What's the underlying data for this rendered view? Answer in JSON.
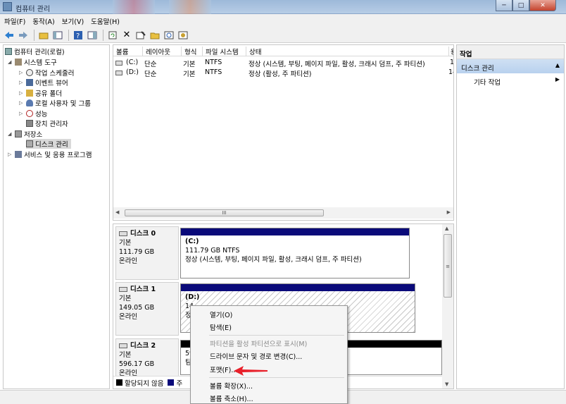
{
  "window": {
    "title": "컴퓨터 관리"
  },
  "menu": [
    "파일(F)",
    "동작(A)",
    "보기(V)",
    "도움말(H)"
  ],
  "toolbar_icons": [
    "back-arrow-icon",
    "forward-arrow-icon",
    "up-folder-icon",
    "show-tree-icon",
    "help-icon",
    "show-panel-icon",
    "refresh-icon",
    "delete-icon",
    "properties-icon",
    "open-folder-icon",
    "search-icon",
    "settings-icon"
  ],
  "tree": {
    "root": "컴퓨터 관리(로컬)",
    "system_tools": "시스템 도구",
    "task_scheduler": "작업 스케줄러",
    "event_viewer": "이벤트 뷰어",
    "shared_folders": "공유 폴더",
    "local_users": "로컬 사용자 및 그룹",
    "performance": "성능",
    "device_manager": "장치 관리자",
    "storage": "저장소",
    "disk_management": "디스크 관리",
    "services": "서비스 및 응용 프로그램"
  },
  "volume_list": {
    "columns": [
      "볼륨",
      "레이아웃",
      "형식",
      "파일 시스템",
      "상태",
      "용"
    ],
    "rows": [
      {
        "volume": "(C:)",
        "layout": "단순",
        "type": "기본",
        "fs": "NTFS",
        "status": "정상 (시스템, 부팅, 페이지 파일, 활성, 크래시 덤프, 주 파티션)",
        "cap": "1"
      },
      {
        "volume": "(D:)",
        "layout": "단순",
        "type": "기본",
        "fs": "NTFS",
        "status": "정상 (활성, 주 파티션)",
        "cap": "14"
      }
    ],
    "scroll_thumb": "III"
  },
  "disks": [
    {
      "name": "디스크 0",
      "type": "기본",
      "size": "111.79 GB",
      "state": "온라인",
      "partition": {
        "label": "(C:)",
        "size": "111.79 GB NTFS",
        "status": "정상 (시스템, 부팅, 페이지 파일, 활성, 크래시 덤프, 주 파티션)"
      }
    },
    {
      "name": "디스크 1",
      "type": "기본",
      "size": "149.05 GB",
      "state": "온라인",
      "partition": {
        "label": "(D:)",
        "size": "14",
        "status": "정"
      }
    },
    {
      "name": "디스크 2",
      "type": "기본",
      "size": "596.17 GB",
      "state": "온라인",
      "partition": {
        "label": "",
        "size": "59",
        "status": "팀"
      }
    }
  ],
  "legend": {
    "unallocated": "할당되지 않음",
    "primary": "주"
  },
  "vscroll_thumb": "≡",
  "actions": {
    "header": "작업",
    "section": "디스크 관리",
    "more": "기타 작업"
  },
  "context_menu": {
    "open": "열기(O)",
    "explore": "탐색(E)",
    "mark_active": "파티션을 활성 파티션으로 표시(M)",
    "change_letter": "드라이브 문자 및 경로 변경(C)...",
    "format": "포맷(F)...",
    "extend": "볼륨 확장(X)...",
    "shrink": "볼륨 축소(H)..."
  },
  "colors": {
    "primary_partition": "#0a0a7a",
    "unallocated": "#000000",
    "arrow": "#e8202a"
  }
}
